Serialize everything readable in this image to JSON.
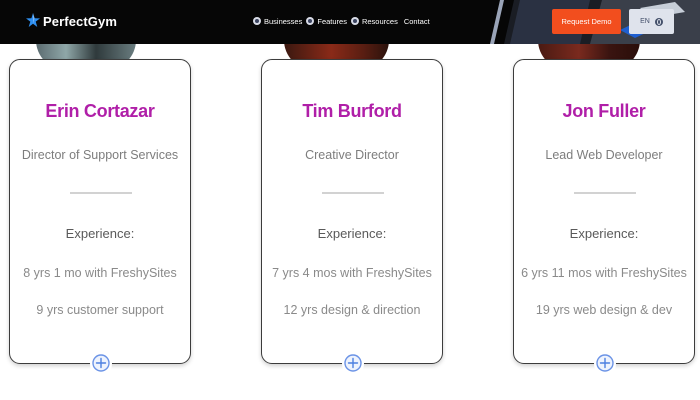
{
  "header": {
    "brand": "PerfectGym",
    "nav": [
      {
        "label": "Businesses",
        "icon": "circle-dot-icon"
      },
      {
        "label": "Features",
        "icon": "circle-dot-icon"
      },
      {
        "label": "Resources",
        "icon": "circle-dot-icon"
      },
      {
        "label": "Contact"
      }
    ],
    "demo_button": "Request Demo",
    "language": "EN"
  },
  "colors": {
    "header_bg": "#060606",
    "accent": "#f24e1e",
    "name": "#b01fa8",
    "plus": "#4c7fe0"
  },
  "team": [
    {
      "name": "Erin Cortazar",
      "role": "Director of Support Services",
      "experience_heading": "Experience:",
      "experience": [
        "8 yrs 1 mo with FreshySites",
        "9 yrs customer support"
      ]
    },
    {
      "name": "Tim Burford",
      "role": "Creative Director",
      "experience_heading": "Experience:",
      "experience": [
        "7 yrs 4 mos with FreshySites",
        "12 yrs design & direction"
      ]
    },
    {
      "name": "Jon Fuller",
      "role": "Lead Web Developer",
      "experience_heading": "Experience:",
      "experience": [
        "6 yrs 11 mos with FreshySites",
        "19 yrs web design & dev"
      ]
    }
  ]
}
